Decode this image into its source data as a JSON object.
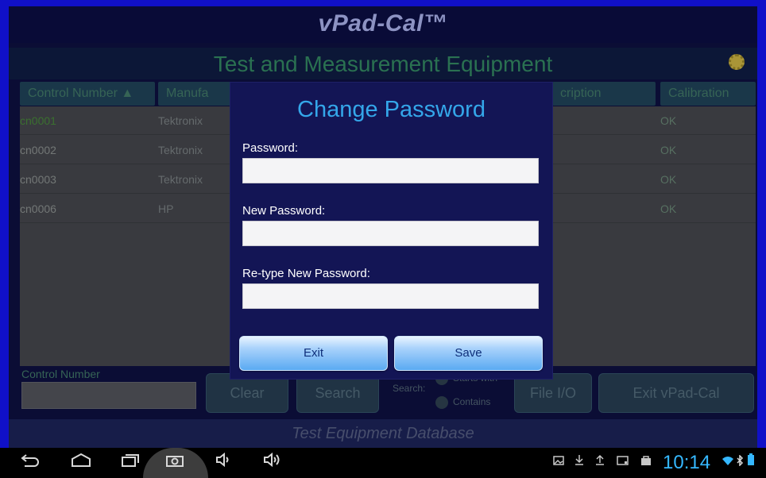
{
  "app": {
    "title": "vPad-Cal™",
    "screen_title": "Test and Measurement Equipment",
    "footer": "Test Equipment Database"
  },
  "table": {
    "columns": [
      "Control Number ▲",
      "Manufa",
      "cription",
      "Calibration"
    ],
    "rows": [
      {
        "control": "cn0001",
        "manufacturer": "Tektronix",
        "calibration": "OK"
      },
      {
        "control": "cn0002",
        "manufacturer": "Tektronix",
        "calibration": "OK"
      },
      {
        "control": "cn0003",
        "manufacturer": "Tektronix",
        "calibration": "OK"
      },
      {
        "control": "cn0006",
        "manufacturer": "HP",
        "calibration": "OK"
      }
    ]
  },
  "bottom": {
    "search_field_label": "Control Number",
    "clear": "Clear",
    "search": "Search",
    "search_mode_label": "Search:",
    "starts_with": "Starts with",
    "contains": "Contains",
    "file_io": "File I/O",
    "exit_app": "Exit vPad-Cal"
  },
  "dialog": {
    "title": "Change Password",
    "password_label": "Password:",
    "password_value": "",
    "new_password_label": "New Password:",
    "new_password_value": "",
    "retype_label": "Re-type New Password:",
    "retype_value": "",
    "exit": "Exit",
    "save": "Save"
  },
  "navbar": {
    "back_icon": "back-icon",
    "home_icon": "home-icon",
    "recents_icon": "recents-icon",
    "screenshot_icon": "camera-icon",
    "volume_down_icon": "volume-down-icon",
    "volume_up_icon": "volume-up-icon",
    "clock": "10:14"
  },
  "colors": {
    "dialog_bg": "#131555",
    "dialog_title": "#34a7ea",
    "clock": "#35b8ff",
    "frame": "#1010c8"
  }
}
